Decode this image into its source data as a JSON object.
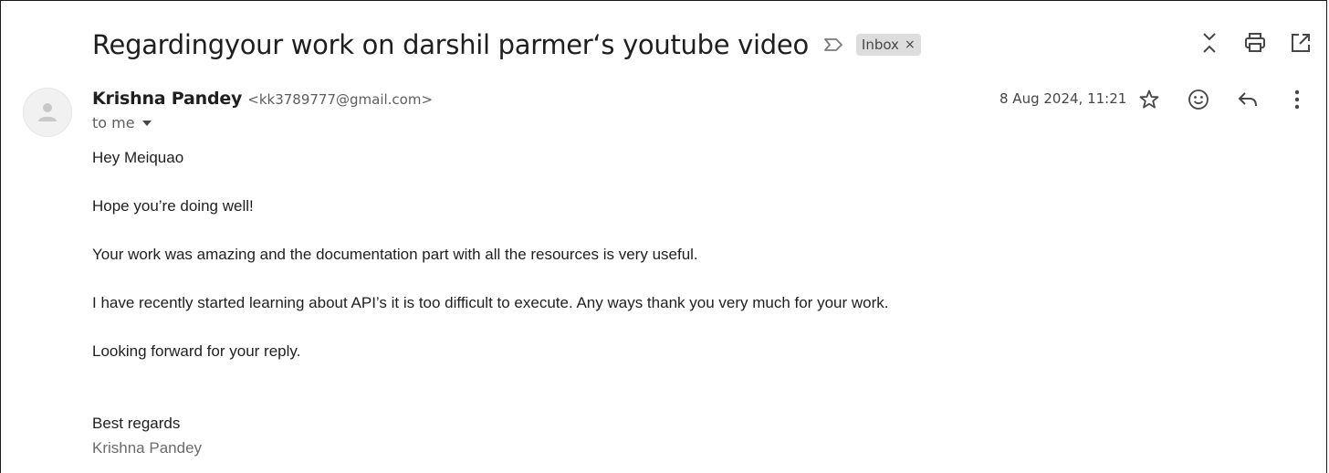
{
  "subject": "Regardingyour work on darshil parmer‘s youtube video",
  "label": {
    "name": "Inbox",
    "remove_glyph": "×"
  },
  "top_actions": [
    "collapse-icon",
    "print-icon",
    "open-in-new-window-icon"
  ],
  "sender": {
    "name": "Krishna Pandey",
    "email": "<kk3789777@gmail.com>"
  },
  "recipient": "to me",
  "date": "8 Aug 2024, 11:21",
  "message_actions": [
    "star-icon",
    "emoji-reaction-icon",
    "reply-icon",
    "more-options-icon"
  ],
  "body": {
    "greeting": "Hey Meiquao",
    "line1": "Hope you’re doing well!",
    "line2": "Your work was amazing and the documentation part with all the resources is very useful.",
    "line3": "I have recently started learning about API’s it is too difficult to execute. Any ways thank you very much for your work.",
    "line4": "Looking forward for your reply.",
    "closing": "Best regards",
    "signature": "Krishna Pandey"
  },
  "colors": {
    "text": "#1f1f1f",
    "muted": "#5e5e5e",
    "chip_bg": "#dddddd",
    "avatar_bg": "#f1f1f1"
  }
}
